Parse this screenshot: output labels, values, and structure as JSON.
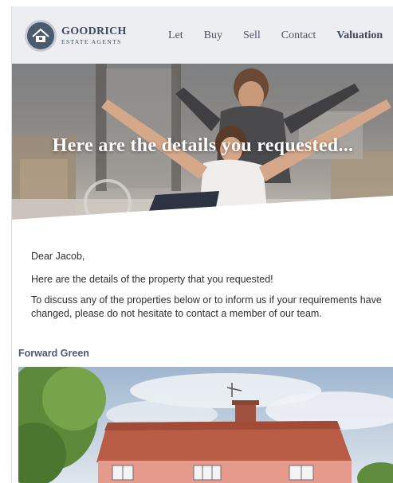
{
  "brand": {
    "name": "GOODRICH",
    "tagline": "ESTATE AGENTS"
  },
  "nav": {
    "items": [
      {
        "label": "Let"
      },
      {
        "label": "Buy"
      },
      {
        "label": "Sell"
      },
      {
        "label": "Contact"
      },
      {
        "label": "Valuation"
      }
    ]
  },
  "hero": {
    "title": "Here are the details you requested..."
  },
  "email": {
    "greeting": "Dear Jacob,",
    "intro": "Here are the details of the property that you requested!",
    "body": "To discuss any of the properties below or to inform us if your requirements have changed, please do not hesitate to contact a member of our team."
  },
  "property": {
    "name": "Forward Green"
  },
  "colors": {
    "header_bg": "#eceef1",
    "brand_navy": "#4c5a6e",
    "link_blue": "#4a5b75"
  }
}
